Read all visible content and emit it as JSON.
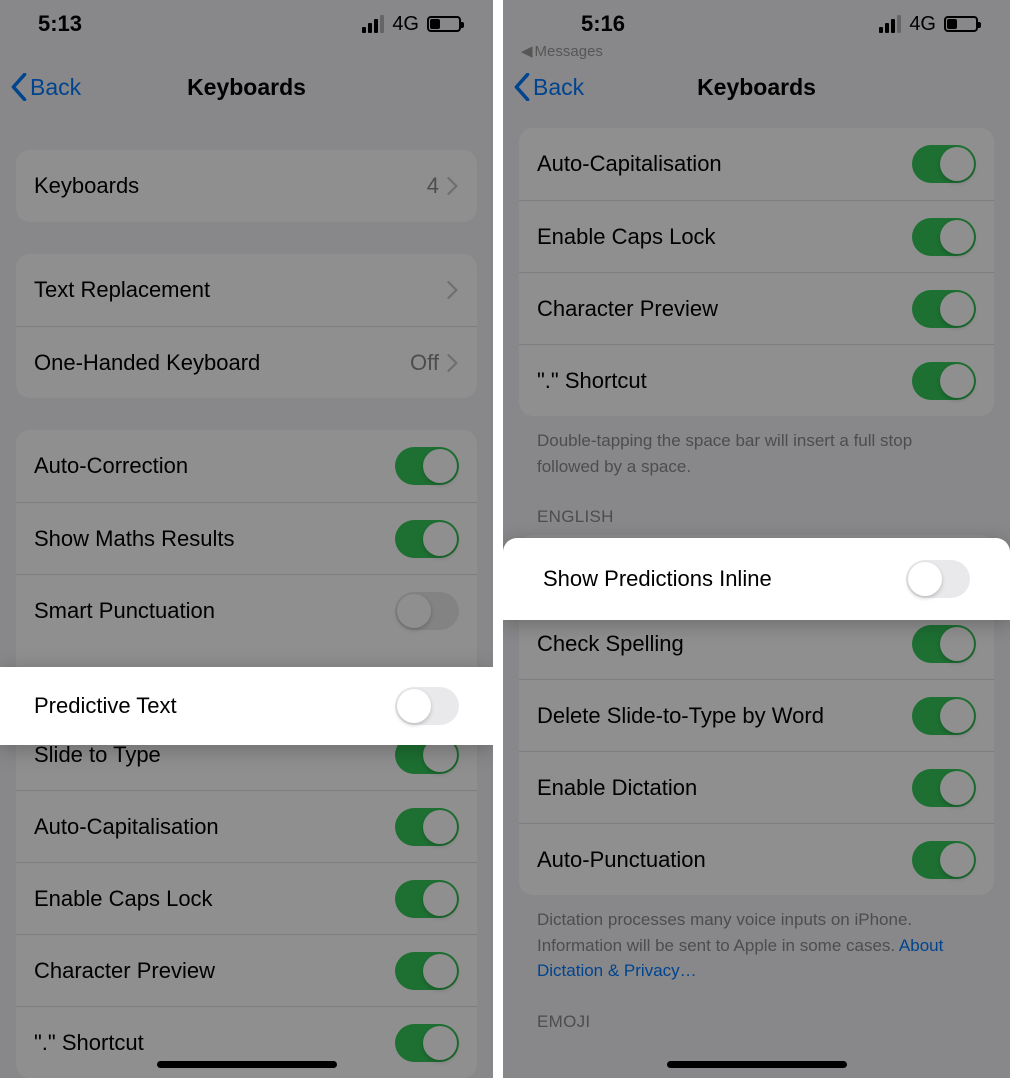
{
  "left": {
    "statusbar": {
      "time": "5:13",
      "network": "4G"
    },
    "nav": {
      "back": "Back",
      "title": "Keyboards"
    },
    "group1": {
      "keyboards_label": "Keyboards",
      "keyboards_value": "4"
    },
    "group2": {
      "text_replacement": "Text Replacement",
      "one_handed_label": "One-Handed Keyboard",
      "one_handed_value": "Off"
    },
    "group3": {
      "auto_correction": "Auto-Correction",
      "show_maths": "Show Maths Results",
      "smart_punctuation": "Smart Punctuation",
      "predictive_text": "Predictive Text",
      "slide_to_type": "Slide to Type",
      "auto_capitalisation": "Auto-Capitalisation",
      "enable_caps_lock": "Enable Caps Lock",
      "character_preview": "Character Preview",
      "dot_shortcut": "\".\" Shortcut"
    }
  },
  "right": {
    "statusbar": {
      "time": "5:16",
      "network": "4G"
    },
    "breadcrumb_app": "Messages",
    "nav": {
      "back": "Back",
      "title": "Keyboards"
    },
    "groupA": {
      "auto_capitalisation": "Auto-Capitalisation",
      "enable_caps_lock": "Enable Caps Lock",
      "character_preview": "Character Preview",
      "dot_shortcut": "\".\" Shortcut"
    },
    "footer_double_tap": "Double-tapping the space bar will insert a full stop followed by a space.",
    "section_english": "ENGLISH",
    "groupB": {
      "show_predictions_inline": "Show Predictions Inline",
      "check_spelling": "Check Spelling",
      "delete_slide_word": "Delete Slide-to-Type by Word",
      "enable_dictation": "Enable Dictation",
      "auto_punctuation": "Auto-Punctuation"
    },
    "footer_dictation": "Dictation processes many voice inputs on iPhone. Information will be sent to Apple in some cases. ",
    "footer_dictation_link": "About Dictation & Privacy…",
    "section_emoji": "EMOJI"
  }
}
